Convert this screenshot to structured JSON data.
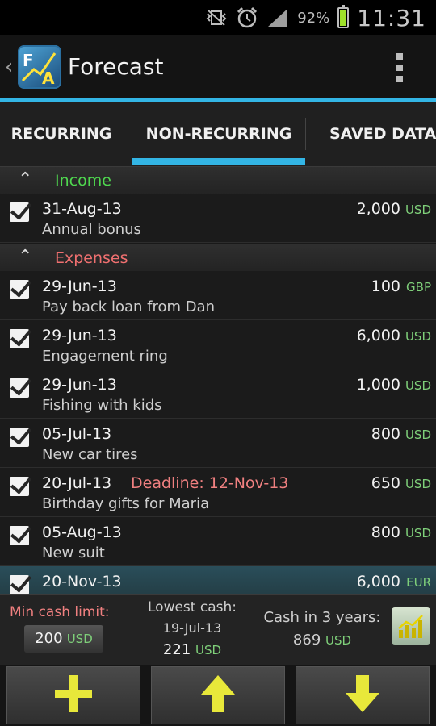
{
  "status_bar": {
    "battery": "92%",
    "battery_level": 0.92,
    "time": "11:31"
  },
  "app_bar": {
    "title": "Forecast",
    "logo_text": "FA",
    "accent_color": "#33b5e5"
  },
  "tabs": [
    {
      "label": "RECURRING",
      "selected": false
    },
    {
      "label": "NON-RECURRING",
      "selected": true
    },
    {
      "label": "SAVED DATA",
      "selected": false
    }
  ],
  "income": {
    "title": "Income",
    "color": "#4fd84f",
    "items": [
      {
        "date": "31-Aug-13",
        "desc": "Annual bonus",
        "amount": "2,000",
        "currency": "USD",
        "checked": true
      }
    ]
  },
  "expenses": {
    "title": "Expenses",
    "color": "#f07070",
    "items": [
      {
        "date": "29-Jun-13",
        "desc": "Pay back loan from Dan",
        "amount": "100",
        "currency": "GBP",
        "checked": true
      },
      {
        "date": "29-Jun-13",
        "desc": "Engagement ring",
        "amount": "6,000",
        "currency": "USD",
        "checked": true
      },
      {
        "date": "29-Jun-13",
        "desc": "Fishing with kids",
        "amount": "1,000",
        "currency": "USD",
        "checked": true
      },
      {
        "date": "05-Jul-13",
        "desc": "New car tires",
        "amount": "800",
        "currency": "USD",
        "checked": true
      },
      {
        "date": "20-Jul-13",
        "deadline": "Deadline: 12-Nov-13",
        "desc": "Birthday gifts for Maria",
        "amount": "650",
        "currency": "USD",
        "checked": true
      },
      {
        "date": "05-Aug-13",
        "desc": "New suit",
        "amount": "800",
        "currency": "USD",
        "checked": true
      },
      {
        "date": "20-Nov-13",
        "desc": "",
        "amount": "6,000",
        "currency": "EUR",
        "checked": true
      }
    ]
  },
  "summary": {
    "min_cash_label": "Min cash limit:",
    "min_cash_value": "200",
    "min_cash_currency": "USD",
    "lowest_label": "Lowest cash:",
    "lowest_date": "19-Jul-13",
    "lowest_value": "221",
    "lowest_currency": "USD",
    "three_years_label": "Cash in 3 years:",
    "three_years_value": "869",
    "three_years_currency": "USD"
  },
  "bottom_buttons": [
    {
      "icon": "plus-icon"
    },
    {
      "icon": "arrow-up-icon"
    },
    {
      "icon": "arrow-down-icon"
    }
  ],
  "button_icon_color": "#e8e83a"
}
